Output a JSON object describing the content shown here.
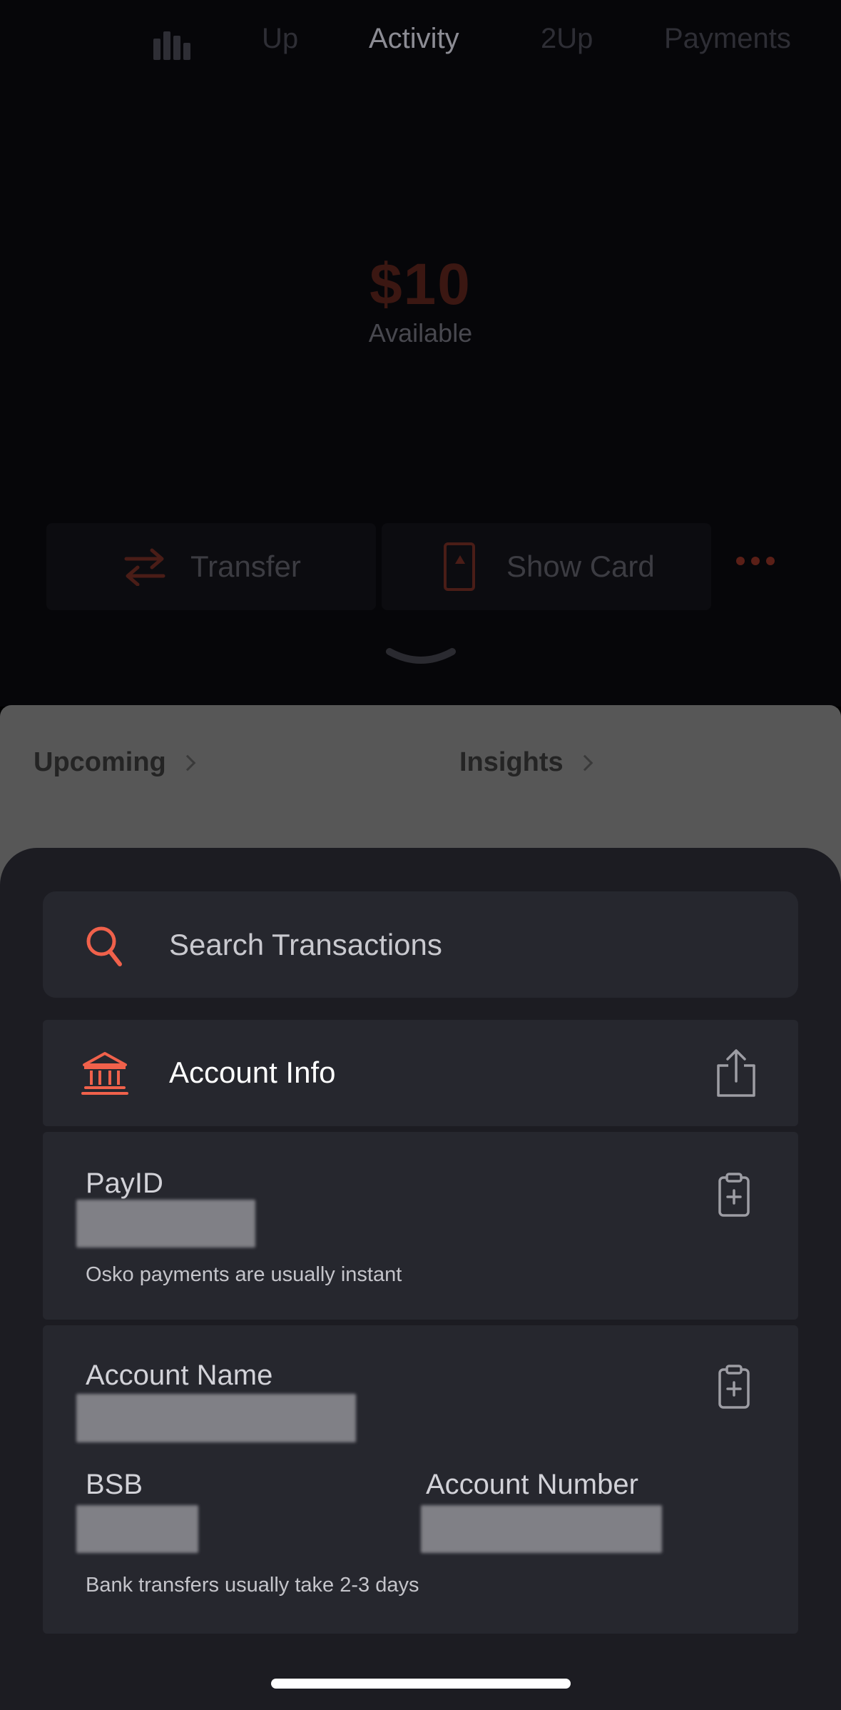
{
  "top_nav": {
    "tabs": [
      "Up",
      "Activity",
      "2Up",
      "Payments"
    ],
    "active_tab": "Activity"
  },
  "balance": {
    "amount": "$10",
    "label": "Available"
  },
  "actions": {
    "transfer_label": "Transfer",
    "show_card_label": "Show Card"
  },
  "dim_links": {
    "upcoming": "Upcoming",
    "insights": "Insights"
  },
  "sheet": {
    "search_placeholder": "Search Transactions",
    "account_info_title": "Account Info",
    "payid": {
      "label": "PayID",
      "hint": "Osko payments are usually instant"
    },
    "account_name_label": "Account Name",
    "bsb_label": "BSB",
    "account_number_label": "Account Number",
    "transfer_hint": "Bank transfers usually take 2-3 days"
  },
  "colors": {
    "accent": "#f0614b",
    "sheet_bg": "#1c1c22",
    "card_bg": "#26272e"
  },
  "icons": [
    "bar-chart-icon",
    "transfer-arrows-icon",
    "card-icon",
    "more-dots-icon",
    "chevron-down-icon",
    "search-icon",
    "bank-icon",
    "share-icon",
    "clipboard-add-icon"
  ]
}
